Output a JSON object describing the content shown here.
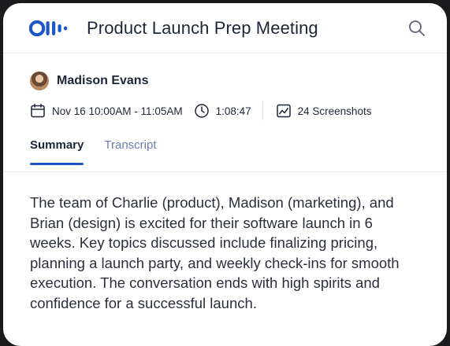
{
  "header": {
    "title": "Product Launch Prep Meeting",
    "logo_icon": "otter-logo-icon",
    "search_icon": "search-icon"
  },
  "meeting": {
    "owner_name": "Madison Evans",
    "datetime": "Nov 16 10:00AM - 11:05AM",
    "duration": "1:08:47",
    "screenshots": "24 Screenshots"
  },
  "tabs": [
    {
      "label": "Summary",
      "active": true
    },
    {
      "label": "Transcript",
      "active": false
    }
  ],
  "summary_text": "The team of Charlie (product), Madison (marketing), and Brian (design) is excited for their software launch in 6 weeks. Key topics discussed include finalizing pricing, planning a launch party, and weekly check-ins for smooth execution. The conversation ends with high spirits and confidence for a successful launch.",
  "colors": {
    "brand_blue": "#1d56c9",
    "text_dark": "#1d2538",
    "tab_inactive": "#6b7bb3"
  }
}
